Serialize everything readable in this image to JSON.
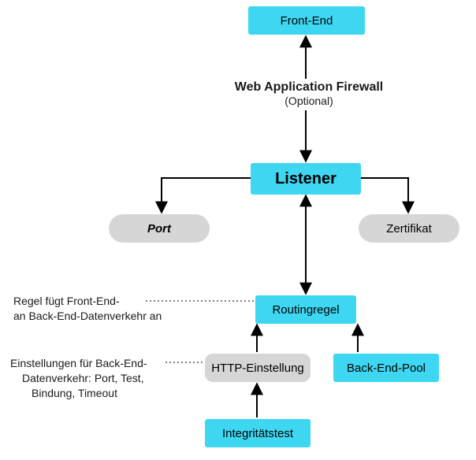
{
  "nodes": {
    "front_end": {
      "label": "Front-End"
    },
    "waf": {
      "title": "Web Application Firewall",
      "subtitle": "(Optional)"
    },
    "listener": {
      "label": "Listener"
    },
    "port": {
      "label": "Port"
    },
    "cert": {
      "label": "Zertifikat"
    },
    "routing": {
      "label": "Routingregel"
    },
    "http_setting": {
      "label": "HTTP-Einstellung"
    },
    "backend_pool": {
      "label": "Back-End-Pool"
    },
    "health_probe": {
      "label": "Integritätstest"
    }
  },
  "annotations": {
    "rule_line1": "Regel fügt Front-End-",
    "rule_line2": "an Back-End-Datenverkehr an",
    "settings_line1": "Einstellungen für Back-End-",
    "settings_line2": "Datenverkehr: Port, Test,",
    "settings_line3": "Bindung, Timeout"
  },
  "colors": {
    "cyan": "#3ed7f2",
    "grey": "#d6d6d6"
  }
}
